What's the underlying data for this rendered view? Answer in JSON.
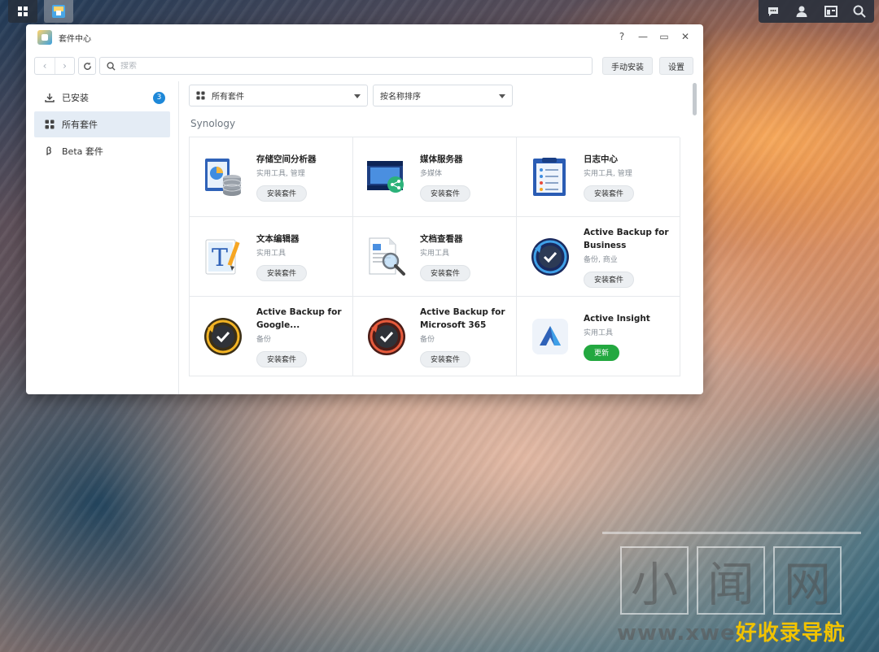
{
  "window": {
    "title": "套件中心",
    "controls": {
      "help": "?",
      "minimize": "—",
      "maximize": "▭",
      "close": "✕"
    }
  },
  "toolbar": {
    "search_placeholder": "搜索",
    "manual_install_label": "手动安装",
    "settings_label": "设置"
  },
  "sidebar": {
    "items": [
      {
        "label": "已安装",
        "badge": "3",
        "icon": "download-icon"
      },
      {
        "label": "所有套件",
        "icon": "grid-icon"
      },
      {
        "label": "Beta 套件",
        "icon": "beta-icon"
      }
    ]
  },
  "filters": {
    "category_value": "所有套件",
    "sort_value": "按名称排序"
  },
  "section_title": "Synology",
  "packages": [
    {
      "name": "存储空间分析器",
      "category": "实用工具, 管理",
      "action": "安装套件",
      "icon": "storage-analyzer-icon"
    },
    {
      "name": "媒体服务器",
      "category": "多媒体",
      "action": "安装套件",
      "icon": "media-server-icon"
    },
    {
      "name": "日志中心",
      "category": "实用工具, 管理",
      "action": "安装套件",
      "icon": "log-center-icon"
    },
    {
      "name": "文本编辑器",
      "category": "实用工具",
      "action": "安装套件",
      "icon": "text-editor-icon"
    },
    {
      "name": "文档查看器",
      "category": "实用工具",
      "action": "安装套件",
      "icon": "document-viewer-icon"
    },
    {
      "name": "Active Backup for Business",
      "category": "备份, 商业",
      "action": "安装套件",
      "icon": "active-backup-business-icon"
    },
    {
      "name": "Active Backup for Google...",
      "category": "备份",
      "action": "安装套件",
      "icon": "active-backup-google-icon"
    },
    {
      "name": "Active Backup for Microsoft 365",
      "category": "备份",
      "action": "安装套件",
      "icon": "active-backup-microsoft-icon"
    },
    {
      "name": "Active Insight",
      "category": "实用工具",
      "action": "更新",
      "icon": "active-insight-icon"
    }
  ],
  "watermark": {
    "chars": [
      "小",
      "闻",
      "网"
    ],
    "url_prefix": "www.xwe",
    "url_highlight": "好收录导航"
  },
  "colors": {
    "accent": "#1e88d8",
    "update_green": "#23a840"
  }
}
